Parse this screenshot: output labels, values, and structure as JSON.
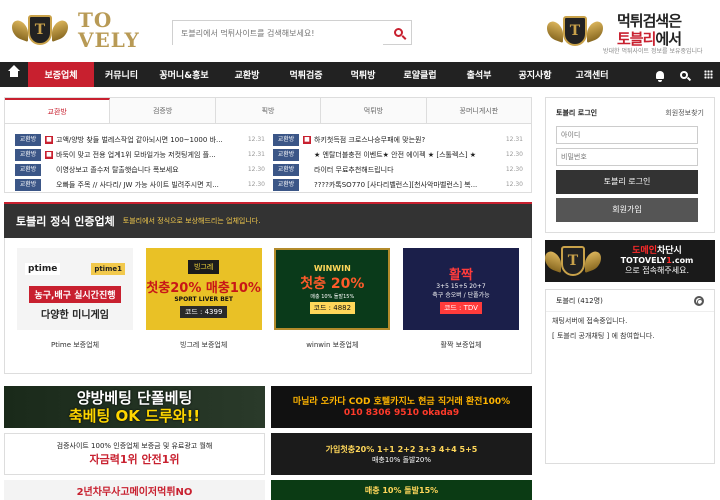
{
  "header": {
    "logo_text_1": "TO",
    "logo_text_2": "VELY",
    "logo_shield_letter": "T",
    "search_placeholder": "토블리에서 먹튀사이트를 검색해보세요!",
    "promo_line1": "먹튀검색은",
    "promo_line2_red": "토블리",
    "promo_line2_rest": "에서",
    "promo_line3": "방대한 먹튀사이트 정보를 보유중입니다"
  },
  "nav": {
    "items": [
      {
        "label": "보증업체",
        "active": true
      },
      {
        "label": "커뮤니티",
        "active": false
      },
      {
        "label": "꽁머니&홍보",
        "active": false
      },
      {
        "label": "교환방",
        "active": false
      },
      {
        "label": "먹튀검증",
        "active": false
      },
      {
        "label": "먹튀방",
        "active": false
      },
      {
        "label": "로얄클럽",
        "active": false
      },
      {
        "label": "출석부",
        "active": false
      },
      {
        "label": "공지사항",
        "active": false
      },
      {
        "label": "고객센터",
        "active": false
      }
    ],
    "accent": "#c8202f"
  },
  "tabs": [
    "교환방",
    "검증방",
    "픽방",
    "먹튀방",
    "꽁머니게시판"
  ],
  "posts_left": [
    {
      "cat": "교환방",
      "hot": true,
      "title": "고액/양방 찾들 벌레스작업 같아뇌시면 100~1000 바...",
      "date": "12.31"
    },
    {
      "cat": "교환방",
      "hot": true,
      "title": "바둑이 맞고 전용 업계1위 모바일가능 저컷팅게임 플...",
      "date": "12.31"
    },
    {
      "cat": "교환방",
      "hot": false,
      "title": "이영상보고 졸수저 탈출햇습니다 폭보세요",
      "date": "12.30"
    },
    {
      "cat": "교환방",
      "hot": false,
      "title": "오빠들 주목 // 사다리/ JW 가능 사이트 빌려주시면 지...",
      "date": "12.30"
    }
  ],
  "posts_right": [
    {
      "cat": "교환방",
      "hot": true,
      "title": "하키첫득점 크로스나승무패에 맞는뭔?",
      "count": "",
      "date": "12.31"
    },
    {
      "cat": "교환방",
      "hot": false,
      "title": "★ 엔탈더블충전 이벤트★ 안전 에이젝 ★ [스톨렉스] ★",
      "count": "",
      "date": "12.30"
    },
    {
      "cat": "교환방",
      "hot": false,
      "title": "라이터 무료추천해드립니다",
      "count": "",
      "date": "12.30"
    },
    {
      "cat": "교환방",
      "hot": false,
      "title": "????카톡SO770 [사다리벨런스][천사악마벨런스] 복...",
      "count": "",
      "date": "12.30"
    }
  ],
  "cert": {
    "title": "토블리 정식 인증업체",
    "subtitle": "토블리에서 정식으로 보상해드리는 업체입니다.",
    "items": [
      {
        "name": "Ptime 보증업체",
        "l1": "ptime",
        "l2": "ptime1",
        "l3": "농구,배구 실시간진행",
        "l4": "다양한 미니게임"
      },
      {
        "name": "빙그레 보증업체",
        "l1": "빙그레",
        "l2": "첫충20% 매충10%",
        "l3": "SPORT LIVER BET",
        "l4": "코드 : 4399"
      },
      {
        "name": "winwin 보증업체",
        "l1": "WINWIN",
        "l2": "첫충 20%",
        "l3": "매충 10% 돌발15%",
        "l4": "코드 : 4882"
      },
      {
        "name": "활짝 보증업체",
        "l1": "활짝",
        "l2": "3+5 15+5 20+7",
        "l3": "축구 승오버 / 단폴가능",
        "l4": "코드 : TDV"
      }
    ]
  },
  "banners": [
    {
      "t1": "양방베팅 단폴베팅",
      "t2": "축베팅 OK 드루와!!"
    },
    {
      "t1": "마닐라 오카다 COD 호텔카지노 현금 직거래 환전100%",
      "t2": "010 8306 9510 okada9"
    },
    {
      "t1": "검증사이트 100% 인증업체 보증금 및 유료광고 월해",
      "t2": "자금력1위 안전1위"
    },
    {
      "t1": "가입첫충20% 1+1 2+2 3+3 4+4 5+5",
      "t2": "매충10% 돌발20%"
    },
    {
      "t1": "2년차무사고메이저먹튀NO"
    },
    {
      "t1": "매충 10% 돌발15%"
    }
  ],
  "login": {
    "title": "토블리 로그인",
    "find": "회원정보찾기",
    "id_placeholder": "아이디",
    "pw_placeholder": "비밀번호",
    "login_button": "토블리 로그인",
    "join_button": "회원가입"
  },
  "side_banner": {
    "l1_red": "도메인",
    "l1_rest": "차단시",
    "l2_a": "TOTOVELY",
    "l2_red": "1",
    "l2_b": ".com",
    "l3": "으로 접속해주세요."
  },
  "chat": {
    "title": "토블리 (412명)",
    "messages": [
      "채팅서버에 접속중입니다.",
      "[ 토블리 공개채팅 ] 에 참여합니다."
    ]
  }
}
